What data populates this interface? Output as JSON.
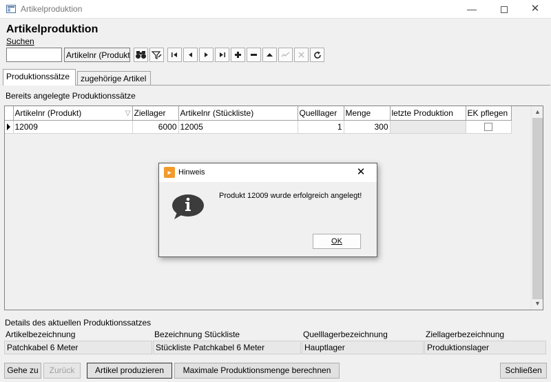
{
  "window": {
    "title": "Artikelproduktion",
    "minimize": "—",
    "close": "✕"
  },
  "page": {
    "title": "Artikelproduktion"
  },
  "search": {
    "label": "Suchen",
    "value": "",
    "field": "Artikelnr (Produkt"
  },
  "toolbar": {
    "icons": [
      "binoculars-icon",
      "filter-icon",
      "first-record-icon",
      "previous-record-icon",
      "next-record-icon",
      "last-record-icon",
      "insert-icon",
      "delete-icon",
      "edit-icon",
      "post-icon",
      "cancel-icon",
      "refresh-icon"
    ]
  },
  "tabs": [
    {
      "label": "Produktionssätze",
      "active": true
    },
    {
      "label": "zugehörige Artikel",
      "active": false
    }
  ],
  "section": {
    "label": "Bereits angelegte Produktionssätze"
  },
  "grid": {
    "columns": [
      "Artikelnr (Produkt)",
      "Ziellager",
      "Artikelnr (Stückliste)",
      "Quelllager",
      "Menge",
      "letzte Produktion",
      "EK pflegen"
    ],
    "rows": [
      {
        "artikelnr": "12009",
        "ziellager": "6000",
        "stueckliste": "12005",
        "quelllager": "1",
        "menge": "300",
        "letzte_produktion": "",
        "ek_pflegen": false
      }
    ]
  },
  "details": {
    "title": "Details des aktuellen Produktionssatzes",
    "fields": [
      {
        "label": "Artikelbezeichnung",
        "value": "Patchkabel 6 Meter"
      },
      {
        "label": "Bezeichnung Stückliste",
        "value": "Stückliste Patchkabel 6 Meter"
      },
      {
        "label": "Quelllagerbezeichnung",
        "value": "Hauptlager"
      },
      {
        "label": "Ziellagerbezeichnung",
        "value": "Produktionslager"
      }
    ]
  },
  "buttons": {
    "gehe_zu": "Gehe zu",
    "zurueck": "Zurück",
    "produzieren": "Artikel produzieren",
    "max_menge": "Maximale Produktionsmenge berechnen",
    "schliessen": "Schließen"
  },
  "dialog": {
    "title": "Hinweis",
    "message": "Produkt 12009 wurde erfolgreich angelegt!",
    "ok": "OK",
    "close": "✕"
  },
  "colors": {
    "dialog_icon": "#f29b2c",
    "info_icon": "#3c3c3c"
  }
}
